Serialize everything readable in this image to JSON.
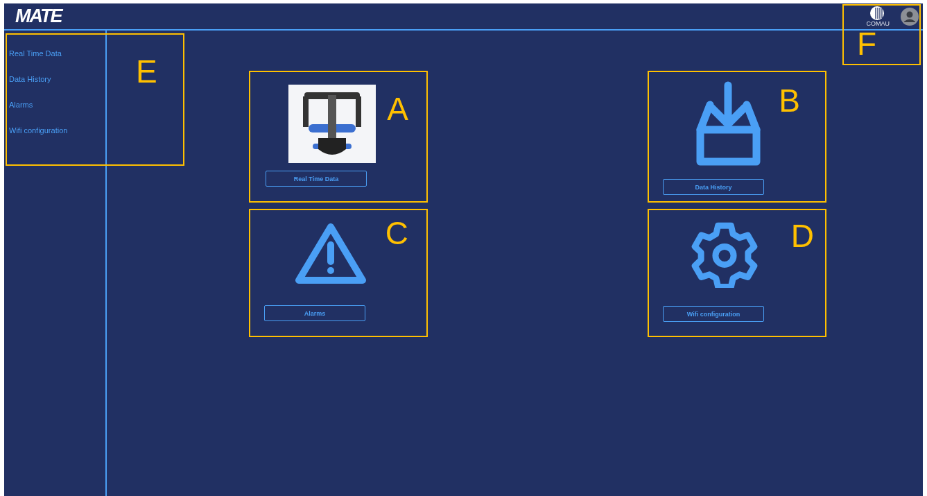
{
  "header": {
    "logo": "MATE",
    "brand_logo_caption": "COMAU"
  },
  "sidebar": {
    "items": [
      {
        "label": "Real Time Data"
      },
      {
        "label": "Data History"
      },
      {
        "label": "Alarms"
      },
      {
        "label": "Wifi configuration"
      }
    ]
  },
  "tiles": [
    {
      "kind": "photo",
      "button": "Real Time Data",
      "annotation": "A"
    },
    {
      "kind": "download",
      "button": "Data History",
      "annotation": "B"
    },
    {
      "kind": "alert",
      "button": "Alarms",
      "annotation": "C"
    },
    {
      "kind": "gear",
      "button": "Wifi configuration",
      "annotation": "D"
    }
  ],
  "annotations": [
    {
      "kind": "sidebar",
      "letter": "E"
    },
    {
      "kind": "header",
      "letter": "F"
    }
  ]
}
